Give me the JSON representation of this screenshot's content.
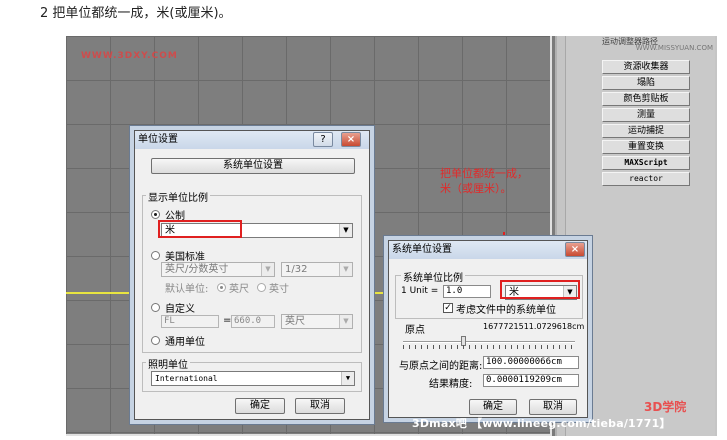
{
  "caption": "2 把单位都统一成，米(或厘米)。",
  "watermarks": {
    "top_left": "WWW.3DXY.COM",
    "right_panel": "WWW.MISSYUAN.COM",
    "credit": "3Dmax吧 【www.lineeg.com/tieba/1771】",
    "logo": "3D学院"
  },
  "right_panel": {
    "top_partial": "运动调整器路径",
    "buttons": [
      "资源收集器",
      "塌陷",
      "颜色剪贴板",
      "测量",
      "运动捕捉",
      "重置变换",
      "MAXScript",
      "reactor"
    ]
  },
  "annotation": {
    "line1": "把单位都统一成，",
    "line2": "米（或厘米）。"
  },
  "units_dialog": {
    "title": "单位设置",
    "help": "?",
    "close": "×",
    "system_units_button": "系统单位设置",
    "display_group": "显示单位比例",
    "metric": "公制",
    "metric_value": "米",
    "us_standard": "美国标准",
    "us_value": "英尺/分数英寸",
    "us_fraction": "1/32",
    "default_units_label": "默认单位:",
    "feet": "英尺",
    "inches": "英寸",
    "custom": "自定义",
    "custom_name": "FL",
    "custom_eq": "=",
    "custom_value": "660.0",
    "custom_unit": "英尺",
    "generic": "通用单位",
    "lighting_group": "照明单位",
    "lighting_value": "International",
    "ok": "确定",
    "cancel": "取消"
  },
  "system_dialog": {
    "title": "系统单位设置",
    "close": "×",
    "scale_group": "系统单位比例",
    "unit_label": "1 Unit =",
    "unit_value": "1.0",
    "unit_select": "米",
    "respect_files": "考虑文件中的系统单位",
    "origin_label": "原点",
    "origin_value": "1677721511.0729618cm",
    "distance_label": "与原点之间的距离:",
    "distance_value": "100.00000066cm",
    "precision_label": "结果精度:",
    "precision_value": "0.0000119209cm",
    "ok": "确定",
    "cancel": "取消"
  },
  "colors": {
    "annotation_red": "#e02020",
    "viewport_gray": "#7e7e7e",
    "yellow_line": "#e8e440"
  }
}
